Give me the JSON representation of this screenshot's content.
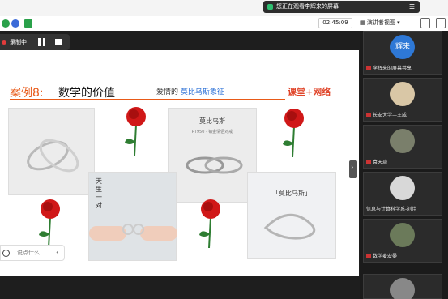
{
  "meeting": {
    "viewing_notice": "您正在观看李辉来的屏幕",
    "timer": "02:45:09",
    "presenter_view": "演讲者视图"
  },
  "recording": {
    "label": "录制中"
  },
  "slide": {
    "case_label": "案例8:",
    "title": "数学的价值",
    "love_prefix": "爱情的",
    "love_highlight": "莫比乌斯象征",
    "brand": "课堂+网络",
    "product_title": "莫比乌斯",
    "product_sub": "PT950 · 铂金情侣对戒",
    "product_title_2": "「莫比乌斯」",
    "vertical_text": "天生一对"
  },
  "chat": {
    "placeholder": "说点什么..."
  },
  "participants": [
    {
      "name": "李辉来的屏幕共享",
      "initials": "辉来"
    },
    {
      "name": "长安大学—王成"
    },
    {
      "name": "袁天琦"
    },
    {
      "name": "信息与计算科学系-刘佳"
    },
    {
      "name": "数学麦宏晏"
    }
  ],
  "colors": {
    "accent": "#e85a18",
    "brand_red": "#e0452a",
    "avatar_blue": "#2e78d6"
  }
}
